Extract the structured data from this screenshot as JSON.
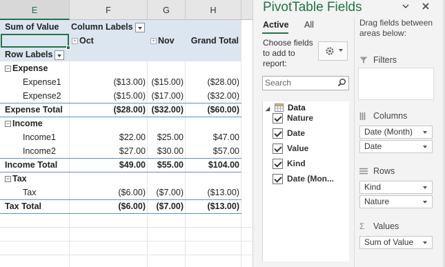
{
  "columns": [
    "E",
    "F",
    "G",
    "H"
  ],
  "pivot": {
    "value_label": "Sum of Value",
    "column_labels": "Column Labels",
    "row_labels": "Row Labels",
    "col_heads": [
      "Oct",
      "Nov",
      "Grand Total"
    ],
    "groups": [
      {
        "name": "Expense",
        "items": [
          {
            "label": "Expense1",
            "oct": "($13.00)",
            "nov": "($15.00)",
            "total": "($28.00)"
          },
          {
            "label": "Expense2",
            "oct": "($15.00)",
            "nov": "($17.00)",
            "total": "($32.00)"
          }
        ],
        "total_label": "Expense Total",
        "total_oct": "($28.00)",
        "total_nov": "($32.00)",
        "total_total": "($60.00)"
      },
      {
        "name": "Income",
        "items": [
          {
            "label": "Income1",
            "oct": "$22.00",
            "nov": "$25.00",
            "total": "$47.00"
          },
          {
            "label": "Income2",
            "oct": "$27.00",
            "nov": "$30.00",
            "total": "$57.00"
          }
        ],
        "total_label": "Income Total",
        "total_oct": "$49.00",
        "total_nov": "$55.00",
        "total_total": "$104.00"
      },
      {
        "name": "Tax",
        "items": [
          {
            "label": "Tax",
            "oct": "($6.00)",
            "nov": "($7.00)",
            "total": "($13.00)"
          }
        ],
        "total_label": "Tax Total",
        "total_oct": "($6.00)",
        "total_nov": "($7.00)",
        "total_total": "($13.00)"
      }
    ]
  },
  "pane": {
    "title": "PivotTable Fields",
    "tabs": [
      "Active",
      "All"
    ],
    "choose_text": "Choose fields to add to report:",
    "search_placeholder": "Search",
    "table_name": "Data",
    "fields": [
      "Nature",
      "Date",
      "Value",
      "Kind",
      "Date (Mon..."
    ],
    "drag_text": "Drag fields between areas below:",
    "areas": {
      "filters": "Filters",
      "columns": "Columns",
      "rows": "Rows",
      "values": "Values"
    },
    "columns_items": [
      "Date (Month)",
      "Date"
    ],
    "rows_items": [
      "Kind",
      "Nature"
    ],
    "values_items": [
      "Sum of Value"
    ]
  },
  "icons": [
    "expand-icon",
    "collapse-icon",
    "dropdown-icon",
    "gear-icon",
    "search-icon",
    "table-icon",
    "filter-icon",
    "columns-icon",
    "rows-icon",
    "sigma-icon",
    "close-icon"
  ],
  "colors": {
    "accent": "#217346",
    "header_band": "#dce6f1",
    "total_rule": "#5b8fce"
  }
}
